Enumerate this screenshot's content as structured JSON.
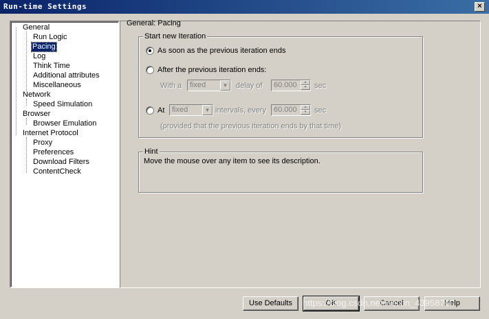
{
  "window": {
    "title": "Run-time Settings",
    "close_label": "×"
  },
  "tree": {
    "nodes": [
      {
        "label": "General"
      },
      {
        "label": "Run Logic"
      },
      {
        "label": "Pacing"
      },
      {
        "label": "Log"
      },
      {
        "label": "Think Time"
      },
      {
        "label": "Additional attributes"
      },
      {
        "label": "Miscellaneous"
      },
      {
        "label": "Network"
      },
      {
        "label": "Speed Simulation"
      },
      {
        "label": "Browser"
      },
      {
        "label": "Browser Emulation"
      },
      {
        "label": "Internet Protocol"
      },
      {
        "label": "Proxy"
      },
      {
        "label": "Preferences"
      },
      {
        "label": "Download Filters"
      },
      {
        "label": "ContentCheck"
      }
    ],
    "selected": "Pacing"
  },
  "panel": {
    "title": "General: Pacing",
    "start_group": {
      "legend": "Start new Iteration",
      "option1": "As soon as the previous iteration ends",
      "option2": "After the previous iteration ends:",
      "with_a": "With a",
      "combo1_value": "fixed",
      "delay_of": "delay of",
      "spin1_value": "60.000",
      "sec1": "sec",
      "option3": "At",
      "combo2_value": "fixed",
      "intervals_every": "intervals, every",
      "spin2_value": "60.000",
      "sec2": "sec",
      "note": "(provided that the previous iteration ends by that time)"
    },
    "hint_group": {
      "legend": "Hint",
      "text": "Move the mouse over any item to see its description."
    }
  },
  "buttons": {
    "use_defaults": "Use Defaults",
    "ok": "OK",
    "cancel": "Cancel",
    "help": "Help"
  },
  "watermark": "https://blog.csdn.net/weixin_43958760"
}
